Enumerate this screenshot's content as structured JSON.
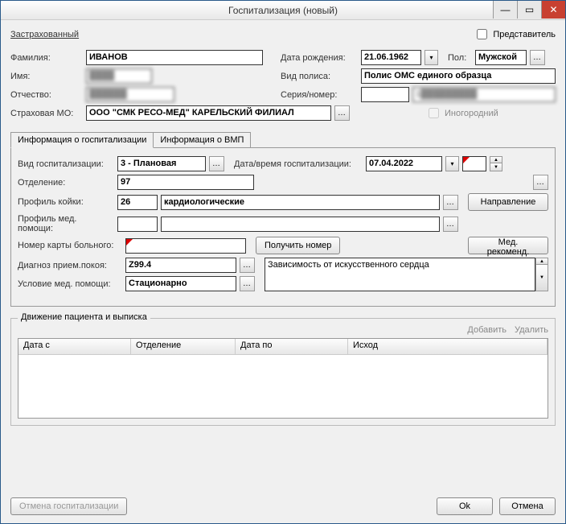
{
  "window": {
    "title": "Госпитализация (новый)"
  },
  "top": {
    "insured_link": "Застрахованный",
    "representative": "Представитель"
  },
  "patient": {
    "lastname_lbl": "Фамилия:",
    "lastname": "ИВАНОВ",
    "firstname_lbl": "Имя:",
    "firstname": "",
    "midname_lbl": "Отчество:",
    "midname": "",
    "dob_lbl": "Дата рождения:",
    "dob": "21.06.1962",
    "sex_lbl": "Пол:",
    "sex": "Мужской",
    "policy_type_lbl": "Вид полиса:",
    "policy_type": "Полис ОМС единого образца",
    "series_lbl": "Серия/номер:",
    "series": "",
    "number": "1",
    "smo_lbl": "Страховая МО:",
    "smo": "ООО \"СМК РЕСО-МЕД\" КАРЕЛЬСКИЙ ФИЛИАЛ",
    "nonresident": "Иногородний"
  },
  "tabs": {
    "t1": "Информация о госпитализации",
    "t2": "Информация о ВМП"
  },
  "hosp": {
    "type_lbl": "Вид госпитализации:",
    "type": "3 - Плановая",
    "dt_lbl": "Дата/время госпитализации:",
    "dt": "07.04.2022",
    "time": "",
    "dept_lbl": "Отделение:",
    "dept": "97",
    "bed_profile_lbl": "Профиль койки:",
    "bed_profile_code": "26",
    "bed_profile_name": "кардиологические",
    "med_profile_lbl": "Профиль мед. помощи:",
    "referral_btn": "Направление",
    "card_no_lbl": "Номер карты больного:",
    "get_no_btn": "Получить номер",
    "recommend_btn": "Мед. рекоменд.",
    "adm_diag_lbl": "Диагноз прием.покоя:",
    "adm_diag": "Z99.4",
    "adm_diag_text": "Зависимость от искусственного сердца",
    "care_cond_lbl": "Условие мед. помощи:",
    "care_cond": "Стационарно"
  },
  "movement": {
    "title": "Движение пациента и выписка",
    "add": "Добавить",
    "delete": "Удалить",
    "cols": {
      "from": "Дата с",
      "dept": "Отделение",
      "to": "Дата по",
      "outcome": "Исход"
    }
  },
  "buttons": {
    "cancel_hosp": "Отмена госпитализации",
    "ok": "Ok",
    "cancel": "Отмена"
  }
}
